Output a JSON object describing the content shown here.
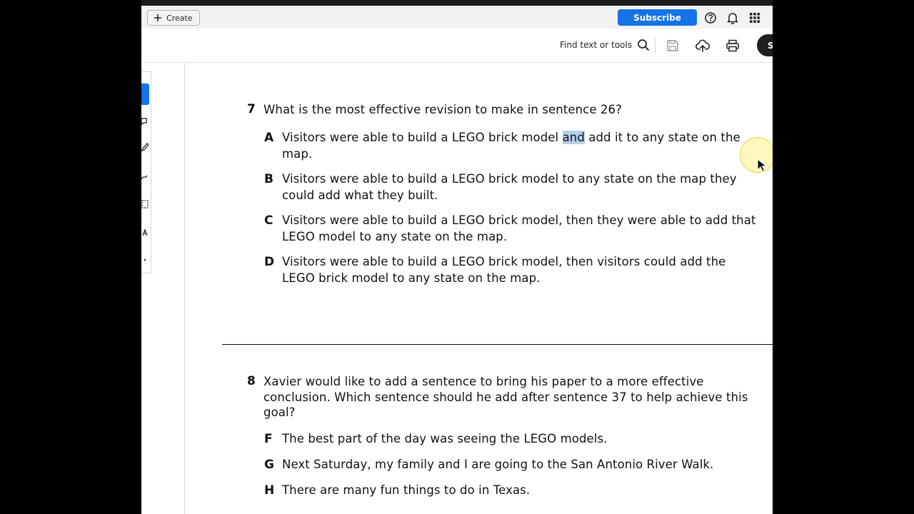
{
  "topbar": {
    "create_label": "Create",
    "subscribe_label": "Subscribe",
    "icons": [
      "help-icon",
      "bell-icon",
      "apps-grid-icon"
    ]
  },
  "toolbar": {
    "find_label": "Find text or tools",
    "sign_label": "S",
    "icons": [
      "search-icon",
      "save-icon",
      "cloud-upload-icon",
      "print-icon"
    ]
  },
  "accent_color": "#1473e6",
  "questions": [
    {
      "number": "7",
      "text": "What is the most effective revision to make in sentence 26?",
      "options": [
        {
          "letter": "A",
          "pre": "Visitors were able to build a LEGO brick model ",
          "highlight": "and",
          "post": " add it to any state on the map."
        },
        {
          "letter": "B",
          "text": "Visitors were able to build a LEGO brick model to any state on the map they could add what they built."
        },
        {
          "letter": "C",
          "text": "Visitors were able to build a LEGO brick model, then they were able to add that LEGO model to any state on the map."
        },
        {
          "letter": "D",
          "text": "Visitors were able to build a LEGO brick model, then visitors could add the LEGO brick model to any state on the map."
        }
      ]
    },
    {
      "number": "8",
      "text": "Xavier would like to add a sentence to bring his paper to a more effective conclusion. Which sentence should he add after sentence 37 to help achieve this goal?",
      "options": [
        {
          "letter": "F",
          "text": "The best part of the day was seeing the LEGO models."
        },
        {
          "letter": "G",
          "text": "Next Saturday, my family and I are going to the San Antonio River Walk."
        },
        {
          "letter": "H",
          "text": "There are many fun things to do in Texas."
        }
      ]
    }
  ]
}
